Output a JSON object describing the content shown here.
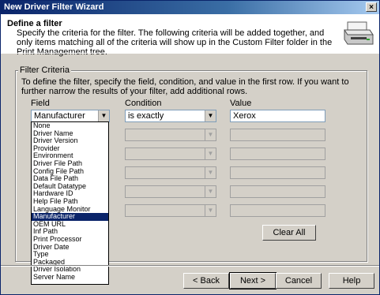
{
  "window": {
    "title": "New Driver Filter Wizard",
    "close_label": "×"
  },
  "header": {
    "title": "Define a filter",
    "description": "Specify the criteria for the filter. The following criteria will be added together, and only items matching all of the criteria will show up in the Custom Filter folder in the Print Management tree."
  },
  "criteria": {
    "group_label": "Filter Criteria",
    "description": "To define the filter, specify the field, condition, and value in the first row. If you want to further narrow the results of your filter, add additional rows.",
    "headers": {
      "field": "Field",
      "condition": "Condition",
      "value": "Value"
    },
    "row1": {
      "field": "Manufacturer",
      "condition": "is exactly",
      "value": "Xerox"
    },
    "clear_all_label": "Clear All"
  },
  "dropdown": {
    "options": [
      "None",
      "Driver Name",
      "Driver Version",
      "Provider",
      "Environment",
      "Driver File Path",
      "Config File Path",
      "Data File Path",
      "Default Datatype",
      "Hardware ID",
      "Help File Path",
      "Language Monitor",
      "Manufacturer",
      "OEM URL",
      "Inf Path",
      "Print Processor",
      "Driver Date",
      "Type",
      "Packaged",
      "Driver Isolation",
      "Server Name"
    ],
    "selected": "Manufacturer"
  },
  "footer": {
    "back_label": "< Back",
    "next_label": "Next >",
    "cancel_label": "Cancel",
    "help_label": "Help"
  }
}
